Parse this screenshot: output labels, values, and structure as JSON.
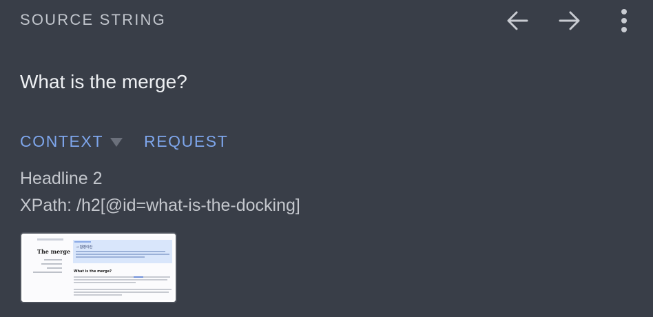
{
  "header": {
    "title": "SOURCE STRING"
  },
  "source": {
    "text": "What is the merge?"
  },
  "tabs": {
    "context_label": "CONTEXT",
    "request_label": "REQUEST"
  },
  "context": {
    "element_type": "Headline 2",
    "xpath": "XPath: /h2[@id=what-is-the-docking]"
  },
  "screenshot": {
    "sidebar_title": "The merge",
    "hero_title": "→ 합병이란",
    "section_heading": "What is the merge?"
  },
  "icons": {
    "prev": "arrow-left-icon",
    "next": "arrow-right-icon",
    "more": "more-vertical-icon",
    "caret": "caret-down-icon"
  },
  "colors": {
    "background": "#393e48",
    "accent": "#7ea6ec",
    "text_primary": "#eef0f3",
    "text_secondary": "#c4c7cd"
  }
}
